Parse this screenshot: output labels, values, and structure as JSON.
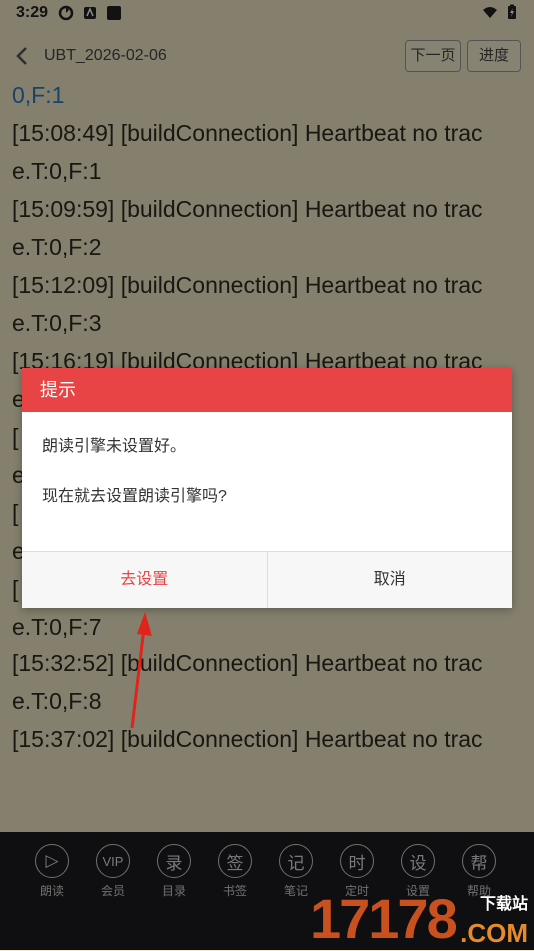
{
  "status_bar": {
    "time": "3:29"
  },
  "top_bar": {
    "title": "UBT_2026-02-06",
    "next_page": "下一页",
    "progress": "进度"
  },
  "reader": {
    "lines": [
      "0,F:1",
      "[15:08:49] [buildConnection] Heartbeat no trac",
      "e.T:0,F:1",
      "[15:09:59] [buildConnection] Heartbeat no trac",
      "e.T:0,F:2",
      "[15:12:09] [buildConnection] Heartbeat no trac",
      "e.T:0,F:3",
      "[15:16:19] [buildConnection] Heartbeat no trac",
      "e",
      "[",
      "e",
      "[",
      "e",
      "[",
      "e.T:0,F:7",
      "[15:32:52] [buildConnection] Heartbeat no trac",
      "e.T:0,F:8",
      "[15:37:02] [buildConnection] Heartbeat no trac"
    ]
  },
  "dialog": {
    "title": "提示",
    "message1": "朗读引擎未设置好。",
    "message2": "现在就去设置朗读引擎吗?",
    "confirm": "去设置",
    "cancel": "取消"
  },
  "bottom_bar": {
    "items": [
      {
        "glyph": "▷",
        "label": "朗读"
      },
      {
        "glyph": "VIP",
        "label": "会员"
      },
      {
        "glyph": "录",
        "label": "目录"
      },
      {
        "glyph": "签",
        "label": "书签"
      },
      {
        "glyph": "记",
        "label": "笔记"
      },
      {
        "glyph": "时",
        "label": "定时"
      },
      {
        "glyph": "设",
        "label": "设置"
      },
      {
        "glyph": "帮",
        "label": "帮助"
      }
    ]
  },
  "watermark": {
    "digits": "17178",
    "site": "下载站",
    "domain": ".COM"
  },
  "colors": {
    "accent_red": "#e84446",
    "paper": "#f3e9c7",
    "toolbar_dark": "#1d1d1f"
  }
}
